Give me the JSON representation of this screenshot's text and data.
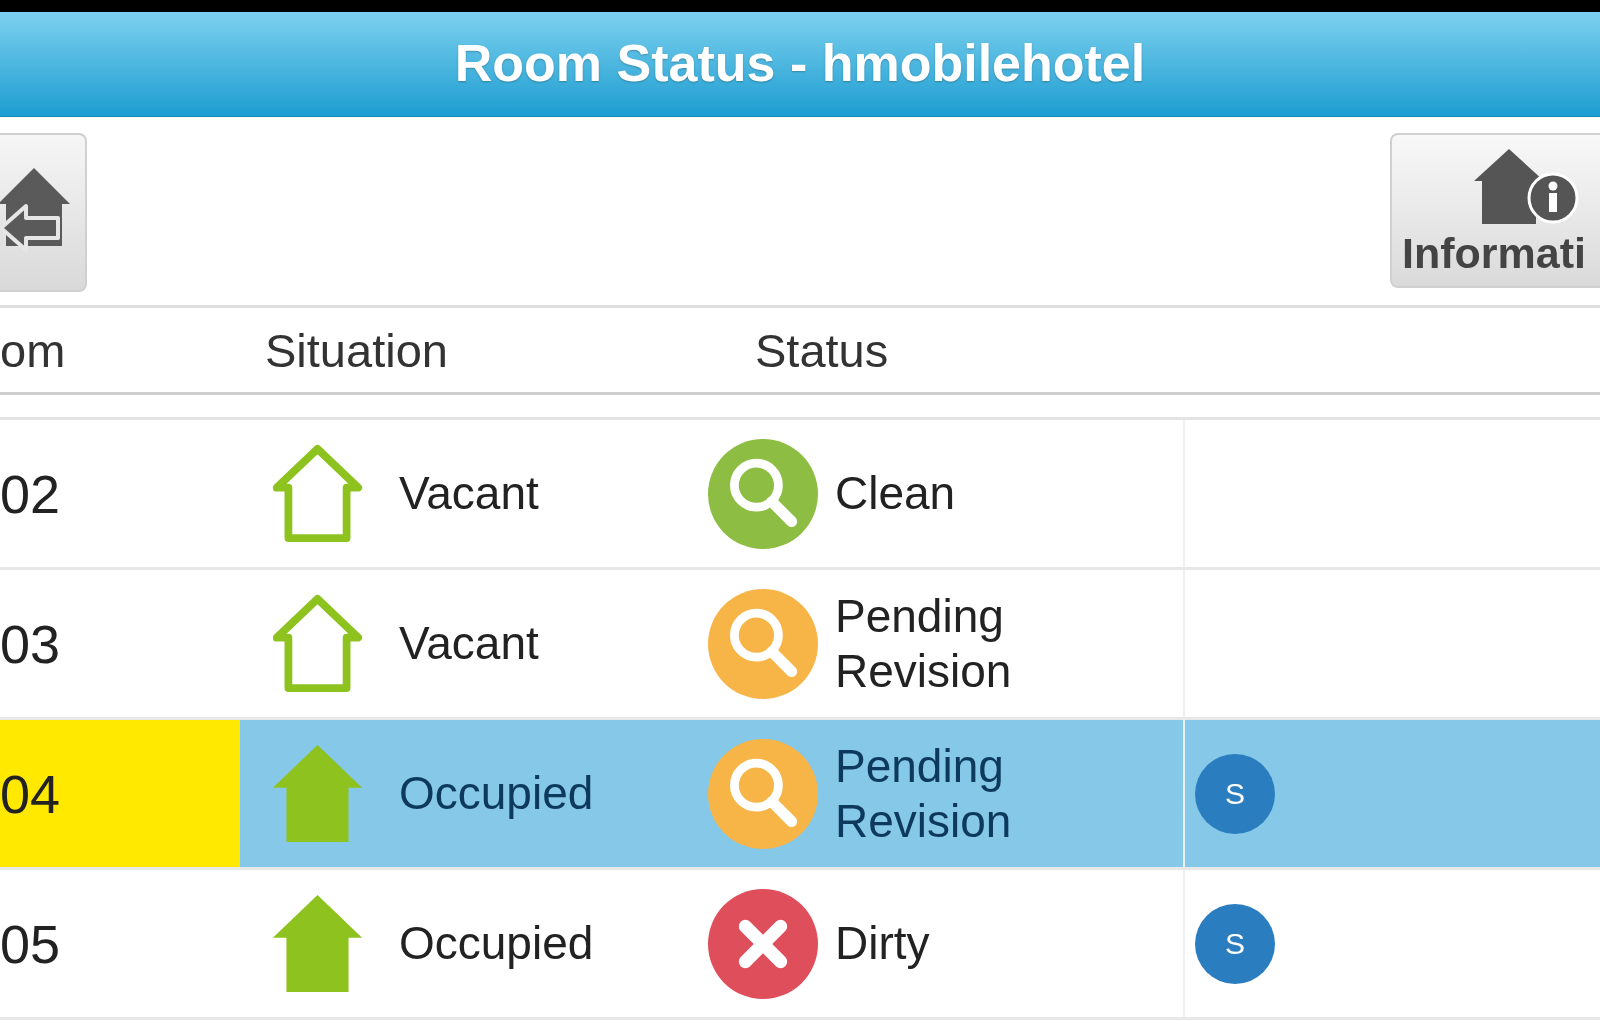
{
  "header": {
    "title": "Room Status - hmobilehotel"
  },
  "toolbar": {
    "info_button": {
      "label": "Informati"
    }
  },
  "table": {
    "columns": [
      "om",
      "Situation",
      "Status"
    ],
    "rows": [
      {
        "room": "02",
        "room_highlighted": false,
        "selected": false,
        "situation": {
          "kind": "vacant",
          "label": "Vacant"
        },
        "status": {
          "kind": "clean",
          "label": "Clean"
        }
      },
      {
        "room": "03",
        "room_highlighted": false,
        "selected": false,
        "situation": {
          "kind": "vacant",
          "label": "Vacant"
        },
        "status": {
          "kind": "pending",
          "label": "Pending Revision"
        }
      },
      {
        "room": "04",
        "room_highlighted": true,
        "selected": true,
        "situation": {
          "kind": "occupied",
          "label": "Occupied"
        },
        "status": {
          "kind": "pending",
          "label": "Pending Revision"
        },
        "badge": "S"
      },
      {
        "room": "05",
        "room_highlighted": false,
        "selected": false,
        "situation": {
          "kind": "occupied",
          "label": "Occupied"
        },
        "status": {
          "kind": "dirty",
          "label": "Dirty"
        },
        "badge": "S"
      }
    ]
  }
}
